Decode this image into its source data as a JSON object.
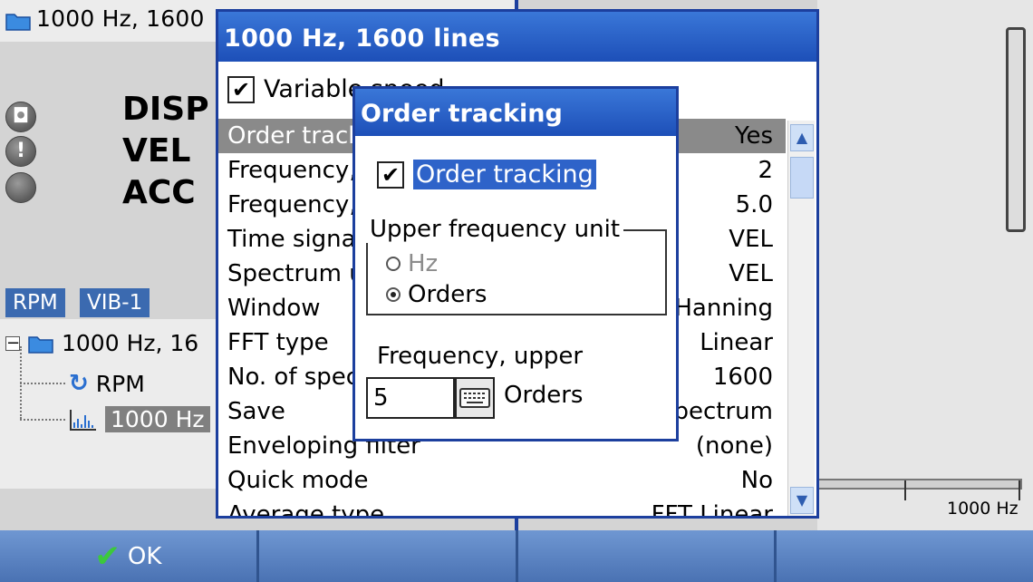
{
  "background": {
    "header_title": "1000 Hz, 1600",
    "measurements": [
      "DISP",
      "VEL",
      "ACC"
    ],
    "chips": [
      "RPM",
      "VIB-1"
    ],
    "tree": {
      "root_label": "1000 Hz, 16",
      "child_rpm": "RPM",
      "child_selected": "1000 Hz"
    },
    "axis_label": "1000 Hz"
  },
  "setup_dialog": {
    "title": "1000 Hz, 1600 lines",
    "variable_speed_label": "Variable speed",
    "variable_speed_checked": true,
    "properties": [
      {
        "label": "Order tracking",
        "value": "Yes",
        "highlighted": true
      },
      {
        "label": "Frequency, upper",
        "value": "2"
      },
      {
        "label": "Frequency, lower",
        "value": "5.0"
      },
      {
        "label": "Time signal unit",
        "value": "VEL"
      },
      {
        "label": "Spectrum unit",
        "value": "VEL"
      },
      {
        "label": "Window",
        "value": "Hanning"
      },
      {
        "label": "FFT type",
        "value": "Linear"
      },
      {
        "label": "No. of spectrum lines",
        "value": "1600"
      },
      {
        "label": "Save",
        "value": "Spectrum"
      },
      {
        "label": "Enveloping filter",
        "value": "(none)"
      },
      {
        "label": "Quick mode",
        "value": "No"
      },
      {
        "label": "Average type",
        "value": "FFT Linear"
      }
    ]
  },
  "order_dialog": {
    "title": "Order tracking",
    "order_tracking_label": "Order tracking",
    "order_tracking_checked": true,
    "group_label": "Upper frequency unit",
    "radio_hz": "Hz",
    "radio_orders": "Orders",
    "selected_unit": "Orders",
    "freq_upper_label": "Frequency, upper",
    "freq_upper_value": "5",
    "freq_upper_unit": "Orders"
  },
  "softkeys": {
    "ok_label": "OK"
  },
  "colors": {
    "titlebar": "#2a62cc",
    "softkey": "#5a82c0",
    "selection": "#2e63c9"
  }
}
